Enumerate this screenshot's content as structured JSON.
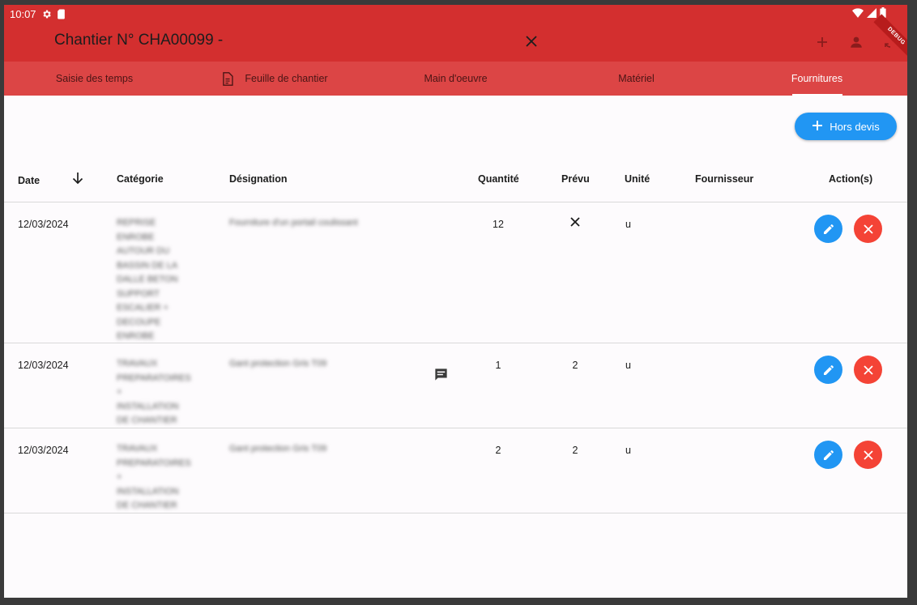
{
  "status_bar": {
    "time": "10:07",
    "debug_label": "DEBUG"
  },
  "app_bar": {
    "title": "Chantier N° CHA00099 -"
  },
  "tabs": [
    {
      "label": "Saisie des temps",
      "active": false
    },
    {
      "label": "Feuille de chantier",
      "active": false
    },
    {
      "label": "Main d'oeuvre",
      "active": false
    },
    {
      "label": "Matériel",
      "active": false
    },
    {
      "label": "Fournitures",
      "active": true
    }
  ],
  "add_button": {
    "label": "Hors devis"
  },
  "table": {
    "columns": [
      "Date",
      "Catégorie",
      "Désignation",
      "Quantité",
      "Prévu",
      "Unité",
      "Fournisseur",
      "Action(s)"
    ],
    "rows": [
      {
        "date": "12/03/2024",
        "categorie": "REPRISE ENROBE AUTOUR DU BASSIN DE LA DALLE BETON SUPPORT ESCALIER + DECOUPE ENROBE",
        "designation": "Fourniture d'un portail coulissant",
        "quantite": "12",
        "prevu": "",
        "prevu_icon": "close-icon",
        "unite": "u",
        "fournisseur": "",
        "has_comment": false
      },
      {
        "date": "12/03/2024",
        "categorie": "TRAVAUX PREPARATOIRES + INSTALLATION DE CHANTIER",
        "designation": "Gant protection Gris T09",
        "quantite": "1",
        "prevu": "2",
        "prevu_icon": "",
        "unite": "u",
        "fournisseur": "",
        "has_comment": true
      },
      {
        "date": "12/03/2024",
        "categorie": "TRAVAUX PREPARATOIRES + INSTALLATION DE CHANTIER",
        "designation": "Gant protection Gris T09",
        "quantite": "2",
        "prevu": "2",
        "prevu_icon": "",
        "unite": "u",
        "fournisseur": "",
        "has_comment": false
      }
    ]
  },
  "colors": {
    "primary": "#d32f2f",
    "tab_bar": "#dc4545",
    "accent_blue": "#2196f3",
    "danger_red": "#f44336",
    "background": "#fdfbfd"
  }
}
